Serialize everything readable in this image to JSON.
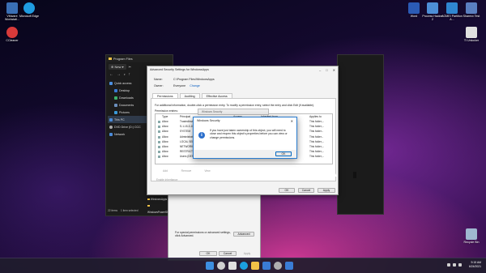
{
  "desktop": {
    "icons_left": [
      {
        "label": "VMware Workstati...",
        "color": "#3a6fb5"
      },
      {
        "label": "Microsoft Edge",
        "color": "#1f9be0"
      },
      {
        "label": "CCleaner",
        "color": "#d83a3a"
      }
    ],
    "icons_right": [
      {
        "label": "Word",
        "color": "#2b5bb5"
      },
      {
        "label": "Process Hacker 2",
        "color": "#4d8fd6"
      },
      {
        "label": "AOMEI Partition A...",
        "color": "#2f86d0"
      },
      {
        "label": "Sharexx Test",
        "color": "#5a7fc0"
      },
      {
        "label": "TI Unlocker",
        "color": "#e0e0e0"
      },
      {
        "label": "Recycle Bin",
        "color": "#9fb7d0"
      }
    ]
  },
  "explorer": {
    "title": "Program Files",
    "new_label": "New",
    "sidebar": [
      {
        "label": "Quick access",
        "color": "#4c8fe0",
        "indent": false
      },
      {
        "label": "Desktop",
        "color": "#3a7bd5",
        "indent": true,
        "pin": true
      },
      {
        "label": "Downloads",
        "color": "#3db36b",
        "indent": true,
        "pin": true
      },
      {
        "label": "Documents",
        "color": "#6b8fbd",
        "indent": true,
        "pin": true
      },
      {
        "label": "Pictures",
        "color": "#3a9ad9",
        "indent": true,
        "pin": true
      },
      {
        "label": "This PC",
        "color": "#4a8ad8",
        "indent": false,
        "selected": true
      },
      {
        "label": "DVD Drive (D:) CCC",
        "color": "#aaaaaa",
        "indent": false
      },
      {
        "label": "Network",
        "color": "#4a8ad8",
        "indent": false
      }
    ],
    "status_items": "22 items",
    "status_selected": "1 item selected"
  },
  "advanced_security": {
    "title": "Advanced Security Settings for WindowsApps",
    "name_label": "Name:",
    "name_value": "C:\\Program Files\\WindowsApps",
    "owner_label": "Owner:",
    "owner_value": "Everyone",
    "owner_change": "Change",
    "tabs": [
      "Permissions",
      "Auditing",
      "Effective Access"
    ],
    "description": "For additional information, double-click a permission entry. To modify a permission entry, select the entry and click Edit (if available).",
    "entries_label": "Permission entries:",
    "columns": [
      "Type",
      "Principal",
      "Access",
      "Inherited from",
      "Applies to"
    ],
    "rows": [
      {
        "type": "Allow",
        "principal": "TrustedInstaller",
        "access": "",
        "inherited": "",
        "applies": "This folder,..."
      },
      {
        "type": "Allow",
        "principal": "S-1-15-3-1024-3...",
        "access": "",
        "inherited": "",
        "applies": "This folder,..."
      },
      {
        "type": "Allow",
        "principal": "SYSTEM",
        "access": "",
        "inherited": "",
        "applies": "This folder..."
      },
      {
        "type": "Allow",
        "principal": "Administrators (D...",
        "access": "",
        "inherited": "",
        "applies": "This folder..."
      },
      {
        "type": "Allow",
        "principal": "LOCAL SERVICE",
        "access": "",
        "inherited": "",
        "applies": "This folder,..."
      },
      {
        "type": "Allow",
        "principal": "NETWORK SERVIC...",
        "access": "",
        "inherited": "",
        "applies": "This folder,..."
      },
      {
        "type": "Allow",
        "principal": "RESTRICTED",
        "access": "Read & e...",
        "inherited": "None",
        "applies": "This folder,..."
      },
      {
        "type": "Allow",
        "principal": "Users (DESKTOP-3GCF...",
        "access": "Read & e...",
        "inherited": "Runas WMI CIYAPPED",
        "applies": "This folder,..."
      }
    ],
    "buttons": {
      "add": "Add",
      "remove": "Remove",
      "view": "View"
    },
    "enable_inheritance": "Enable inheritance",
    "footer": {
      "ok": "OK",
      "cancel": "Cancel",
      "apply": "Apply"
    }
  },
  "windows_security_small": {
    "title": "Windows Security"
  },
  "windows_security": {
    "title": "Windows Security",
    "message": "If you have just taken ownership of this object, you will need to close and reopen this object's properties before you can view or change permissions.",
    "ok": "OK"
  },
  "permissions_fragment": {
    "text": "For special permissions or advanced settings, click Advanced.",
    "advanced": "Advanced",
    "ok": "OK",
    "cancel": "Cancel",
    "apply": "Apply"
  },
  "behind_window": {
    "items": [
      "WindowsApps",
      "WindowsPowerShell"
    ]
  },
  "taskbar": {
    "icons": [
      {
        "name": "start",
        "color": "#3d8fe0"
      },
      {
        "name": "search",
        "color": "#cfcfcf"
      },
      {
        "name": "task-view",
        "color": "#e0e0e0"
      },
      {
        "name": "edge",
        "color": "#1ba0df"
      },
      {
        "name": "file-explorer",
        "color": "#f2c247"
      },
      {
        "name": "store",
        "color": "#3a7cd6"
      },
      {
        "name": "settings",
        "color": "#b0b0b0"
      },
      {
        "name": "security",
        "color": "#3a7cd6"
      }
    ],
    "time": "9:15 AM",
    "date": "6/24/2021"
  }
}
